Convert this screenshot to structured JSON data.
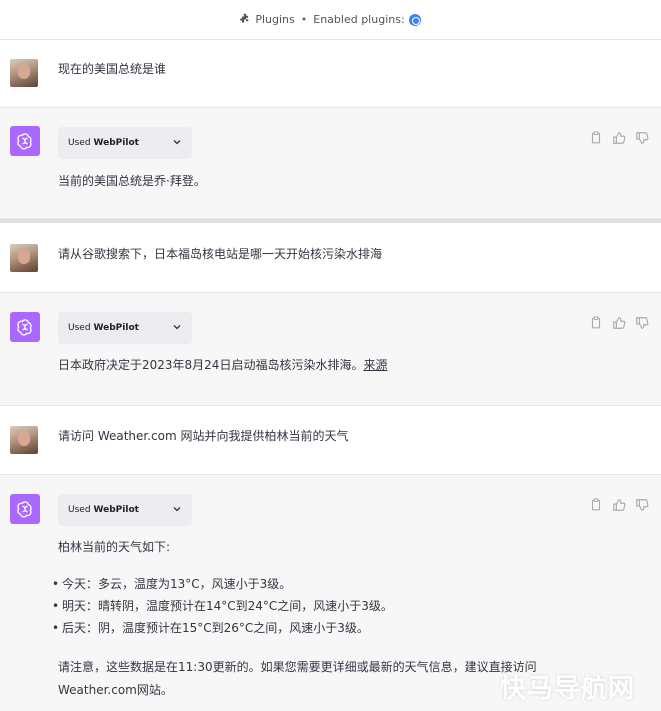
{
  "topbar": {
    "plugins_label": "Plugins",
    "separator": "•",
    "enabled_label": "Enabled plugins:"
  },
  "conversation": [
    {
      "role": "user",
      "text": "现在的美国总统是谁"
    },
    {
      "role": "assistant",
      "used_prefix": "Used",
      "used_plugin": "WebPilot",
      "text": "当前的美国总统是乔·拜登。"
    },
    {
      "role": "user",
      "text": "请从谷歌搜索下，日本福岛核电站是哪一天开始核污染水排海"
    },
    {
      "role": "assistant",
      "used_prefix": "Used",
      "used_plugin": "WebPilot",
      "text": "日本政府决定于2023年8月24日启动福岛核污染水排海。",
      "link_text": "来源"
    },
    {
      "role": "user",
      "text": "请访问 Weather.com 网站并向我提供柏林当前的天气"
    },
    {
      "role": "assistant",
      "used_prefix": "Used",
      "used_plugin": "WebPilot",
      "intro": "柏林当前的天气如下:",
      "bullets": [
        "今天：多云，温度为13°C，风速小于3级。",
        "明天：晴转阴，温度预计在14°C到24°C之间，风速小于3级。",
        "后天：阴，温度预计在15°C到26°C之间，风速小于3级。"
      ],
      "note_line1": "请注意，这些数据是在11:30更新的。如果您需要更详细或最新的天气信息，建议直接访问",
      "note_line2": "Weather.com网站。"
    }
  ],
  "watermark": "快马导航网",
  "colors": {
    "assistant_avatar": "#ab68ff",
    "assistant_row_bg": "#f7f7f8",
    "pill_bg": "#ececf1"
  }
}
